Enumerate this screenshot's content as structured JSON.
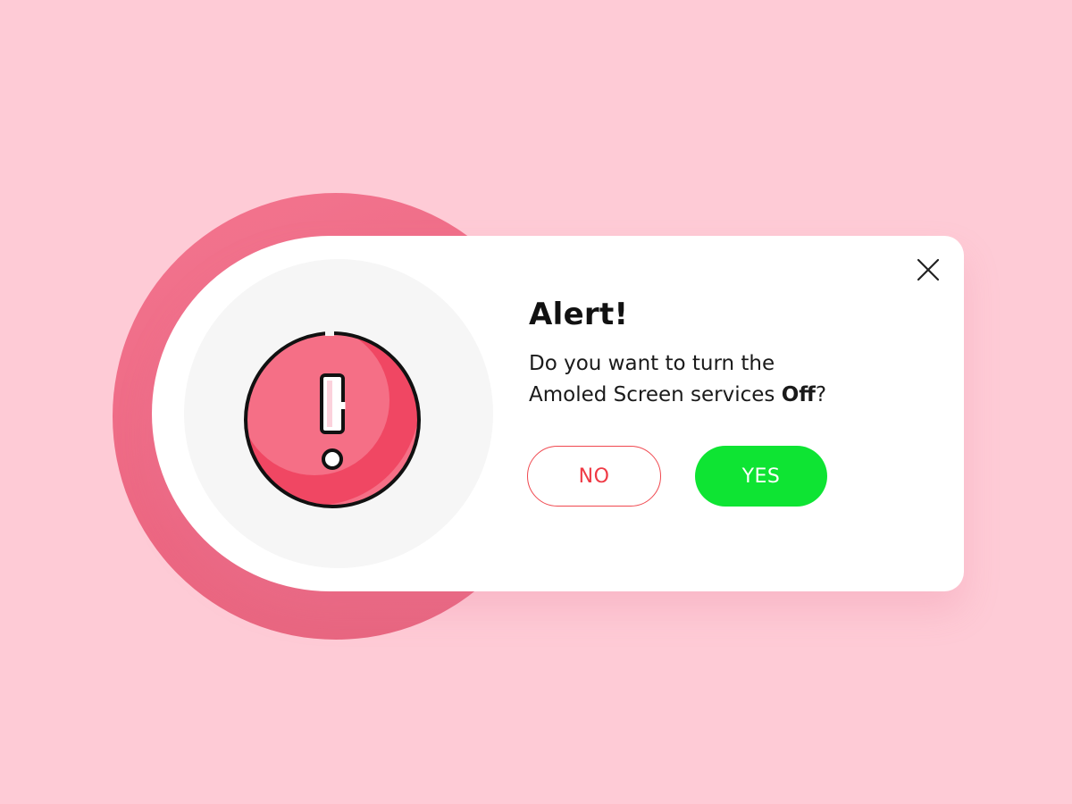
{
  "dialog": {
    "title": "Alert!",
    "message_line1": "Do you want to turn the",
    "message_line2": "Amoled Screen services",
    "message_emphasis": "Off",
    "message_end": "?",
    "no_label": "NO",
    "yes_label": "YES",
    "close_icon": "close-icon",
    "alert_icon": "exclamation-circle-icon"
  },
  "colors": {
    "background": "#fecbd6",
    "accent_disc": "#ef6c86",
    "no_border": "#f0484f",
    "yes_fill": "#0ee433",
    "icon_red": "#f56f86"
  }
}
